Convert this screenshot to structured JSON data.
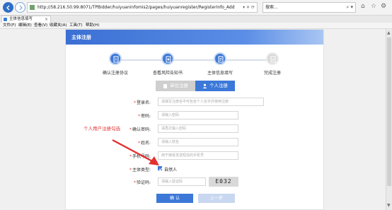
{
  "browser": {
    "url": "http://58.216.50.99:8071/TPBidder/huiyuaninfomis2/pages/huiyuanregister/RegisterInfo_Add",
    "search_placeholder": "搜索...",
    "tab_title": "主体信息填写",
    "menu": [
      "文件(F)",
      "编辑(E)",
      "查看(V)",
      "收藏夹(A)",
      "工具(T)",
      "帮助(H)"
    ]
  },
  "page": {
    "header_title": "主体注册",
    "steps": [
      {
        "label": "确认注册协议",
        "active": true
      },
      {
        "label": "查看风险告知书",
        "active": true
      },
      {
        "label": "主体信息填写",
        "active": true
      },
      {
        "label": "完成注册",
        "active": false
      }
    ],
    "tabs": {
      "unit": "单位注册",
      "personal": "个人注册",
      "selected": "personal"
    },
    "form": {
      "login": {
        "label": "登录名:",
        "placeholder": "请填写注册名中可包含个人名字并使用注册"
      },
      "password": {
        "label": "密码:",
        "placeholder": "请输入密码"
      },
      "confirm_password": {
        "label": "确认密码:",
        "placeholder": "请再次输入密码"
      },
      "name": {
        "label": "姓名:",
        "placeholder": "请输入姓名"
      },
      "phone": {
        "label": "手机号码:",
        "placeholder": "用于接受发送短信的手机号"
      },
      "subject_type": {
        "label": "主体类型:",
        "option": "自然人",
        "checked": true
      },
      "captcha": {
        "label": "验证码:",
        "placeholder": "请输入验证码",
        "code": "E032"
      }
    },
    "buttons": {
      "confirm": "确 认",
      "prev": "上一步"
    },
    "annotation": "个人用户注册勾选"
  },
  "colors": {
    "accent": "#3c78d8",
    "required": "#e23b3b",
    "annotation": "#e23030"
  }
}
